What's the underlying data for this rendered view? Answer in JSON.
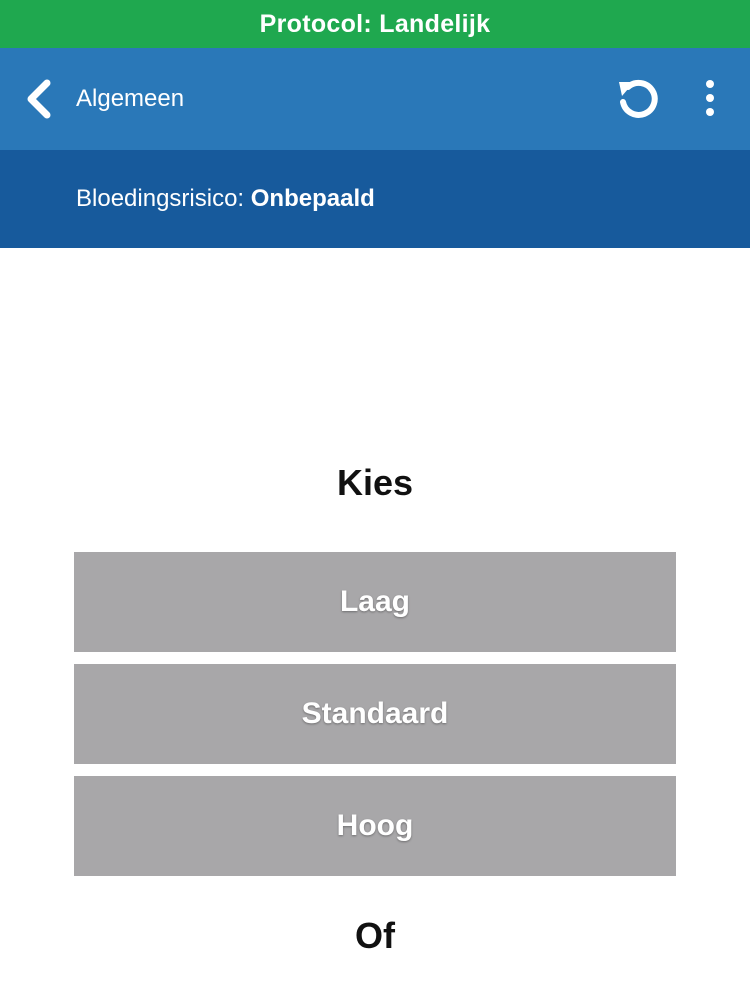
{
  "protocol_bar": {
    "label": "Protocol: Landelijk",
    "color": "#1fa84f"
  },
  "header": {
    "back_label": "Algemeen",
    "back_icon": "chevron-left-icon",
    "reset_icon": "reset-icon",
    "more_icon": "more-vertical-icon",
    "color": "#2a78b8"
  },
  "risk": {
    "label": "Bloedingsrisico: ",
    "value": "Onbepaald",
    "color": "#175a9c"
  },
  "main": {
    "choose_heading": "Kies",
    "options": [
      {
        "label": "Laag"
      },
      {
        "label": "Standaard"
      },
      {
        "label": "Hoog"
      }
    ],
    "or_heading": "Of",
    "button_color": "#a8a7a9"
  }
}
